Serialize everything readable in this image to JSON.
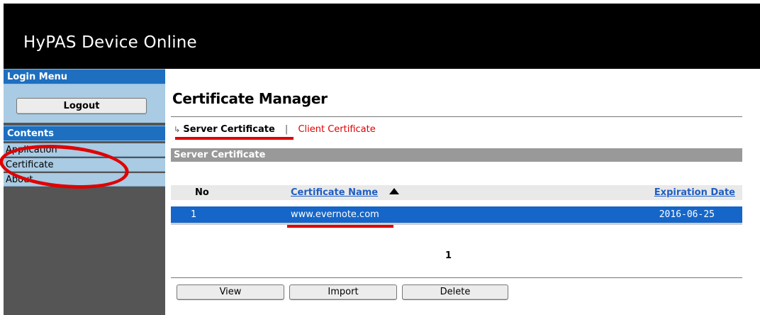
{
  "header": {
    "title": "HyPAS Device Online"
  },
  "sidebar": {
    "login_menu_label": "Login Menu",
    "logout_label": "Logout",
    "contents_label": "Contents",
    "items": [
      {
        "label": "Application"
      },
      {
        "label": "Certificate"
      },
      {
        "label": "About"
      }
    ]
  },
  "main": {
    "title": "Certificate Manager",
    "tabs": {
      "server": "Server Certificate",
      "separator": "|",
      "client": "Client Certificate"
    },
    "section_title": "Server Certificate",
    "table": {
      "columns": [
        "No",
        "Certificate Name",
        "Expiration Date"
      ],
      "rows": [
        {
          "no": "1",
          "name": "www.evernote.com",
          "expiration": "2016-06-25"
        }
      ]
    },
    "pager": "1",
    "buttons": {
      "view": "View",
      "import": "Import",
      "delete": "Delete"
    }
  },
  "colors": {
    "header_bg": "#000000",
    "sidebar_head": "#1e6fbf",
    "sidebar_item_bg": "#a9cbe3",
    "selected_row": "#1566c8",
    "link": "#1f5ec1",
    "highlight_red": "#e00000"
  },
  "icons": {
    "tab_marker": "arrow-return-icon",
    "sort": "sort-ascending-icon"
  }
}
